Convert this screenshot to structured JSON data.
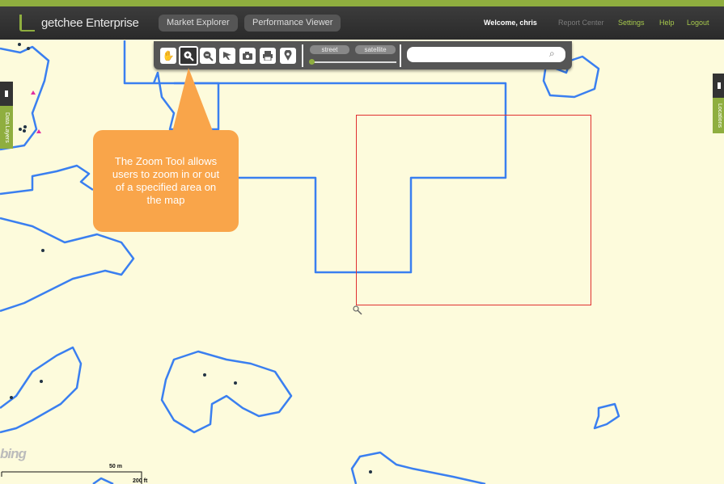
{
  "app": {
    "logo_text": "getchee Enterprise",
    "nav": [
      "Market Explorer",
      "Performance Viewer"
    ],
    "welcome": "Welcome, chris",
    "links": [
      {
        "label": "Report Center",
        "color": "#7a7a7a"
      },
      {
        "label": "Settings",
        "color": "#a6c84c"
      },
      {
        "label": "Help",
        "color": "#a6c84c"
      },
      {
        "label": "Logout",
        "color": "#a6c84c"
      }
    ],
    "accent": "#8fae3f"
  },
  "toolbar": {
    "tools": [
      "pan-icon",
      "zoom-in-icon",
      "zoom-out-icon",
      "select-arrow-icon",
      "camera-icon",
      "print-icon",
      "location-pin-icon"
    ],
    "active_tool": "zoom-in-icon",
    "map_types": [
      "street",
      "satellite"
    ],
    "search_placeholder": "",
    "search_icon": "magnifier-icon"
  },
  "side_tabs": {
    "left": "Data Layers",
    "right": "Locations"
  },
  "callout": {
    "text": "The Zoom Tool allows users to zoom in or out of a specified area on the map",
    "color": "#f9a54a"
  },
  "map": {
    "provider_logo": "bing",
    "scale_top": "50 m",
    "scale_bottom": "200 ft",
    "boundary_color": "#3a7ff0",
    "selection_color": "#e03030",
    "marker_color": "#e02ea0"
  }
}
